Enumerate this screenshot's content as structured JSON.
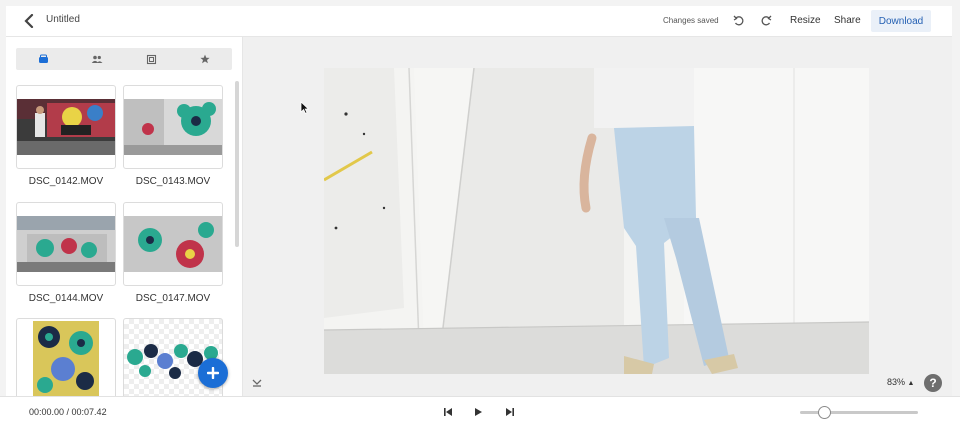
{
  "header": {
    "back_icon": "chevron-left-icon",
    "title": "Untitled",
    "status": "Changes saved",
    "undo_icon": "undo-icon",
    "redo_icon": "redo-icon",
    "resize_label": "Resize",
    "share_label": "Share",
    "download_label": "Download"
  },
  "sidebar": {
    "tabs": [
      {
        "icon": "media-tray-icon",
        "active": true
      },
      {
        "icon": "people-icon"
      },
      {
        "icon": "image-frame-icon"
      },
      {
        "icon": "star-icon"
      }
    ],
    "media": [
      {
        "label": "DSC_0142.MOV"
      },
      {
        "label": "DSC_0143.MOV"
      },
      {
        "label": "DSC_0144.MOV"
      },
      {
        "label": "DSC_0147.MOV"
      },
      {
        "label": ""
      },
      {
        "label": ""
      }
    ],
    "add_button_icon": "plus-icon"
  },
  "canvas": {
    "zoom": "83%",
    "help_label": "?",
    "accent_color": "#1b6ed6"
  },
  "footer": {
    "timecode": "00:00.00 / 00:07.42",
    "controls": [
      "skip-back-icon",
      "play-icon",
      "skip-forward-icon"
    ],
    "zoom_slider_level": 0.2
  }
}
